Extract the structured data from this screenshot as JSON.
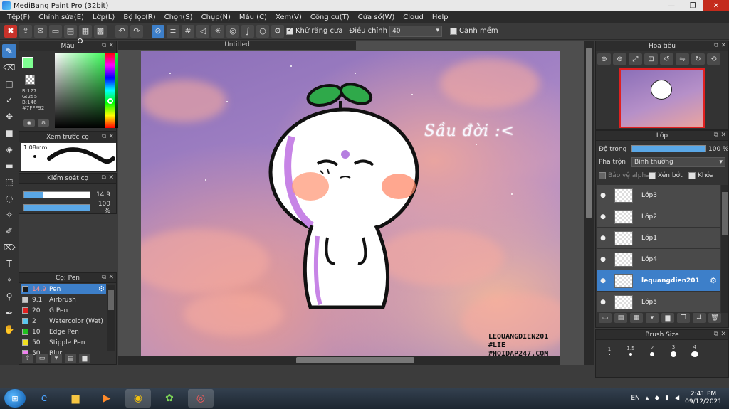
{
  "window": {
    "title": "MediBang Paint Pro (32bit)",
    "min": "—",
    "max": "❐",
    "close": "✕"
  },
  "menu": [
    "Tệp(F)",
    "Chỉnh sửa(E)",
    "Lớp(L)",
    "Bộ lọc(R)",
    "Chọn(S)",
    "Chụp(N)",
    "Màu (C)",
    "Xem(V)",
    "Công cụ(T)",
    "Cửa sổ(W)",
    "Cloud",
    "Help"
  ],
  "toolbar": {
    "antialias_label": "Khử răng cưa",
    "adjust_label": "Điều chỉnh",
    "adjust_value": "40",
    "edge_label": "Cạnh mềm"
  },
  "panels": {
    "color": {
      "title": "Màu",
      "fg_color": "#7fff92",
      "r": "R:127",
      "g": "G:255",
      "b": "B:146",
      "hex": "#7FFF92"
    },
    "preview": {
      "title": "Xem trước cọ",
      "size": "1.08mm"
    },
    "control": {
      "title": "Kiểm soát cọ",
      "size_value": "14.9",
      "size_fill": 0.28,
      "opacity_value": "100 %",
      "opacity_fill": 1.0
    },
    "brush": {
      "title": "Cọ: Pen",
      "items": [
        {
          "size": "14.9",
          "name": "Pen",
          "color": "#1a1a1a",
          "selected": true
        },
        {
          "size": "9.1",
          "name": "Airbrush",
          "color": "#c8c8c8"
        },
        {
          "size": "20",
          "name": "G Pen",
          "color": "#e02020"
        },
        {
          "size": "2",
          "name": "Watercolor (Wet)",
          "color": "#5ac8f0"
        },
        {
          "size": "10",
          "name": "Edge Pen",
          "color": "#20c020"
        },
        {
          "size": "50",
          "name": "Stipple Pen",
          "color": "#f0e020"
        },
        {
          "size": "50",
          "name": "Blur",
          "color": "#f080f0"
        }
      ]
    },
    "navigator": {
      "title": "Hoa tiêu"
    },
    "layer": {
      "title": "Lớp",
      "opacity_label": "Độ trong",
      "opacity_value": "100 %",
      "blend_label": "Pha trộn",
      "blend_value": "Bình thường",
      "protect_alpha": "Bảo vệ alpha",
      "clipping": "Xén bớt",
      "lock": "Khóa",
      "layers": [
        "Lớp3",
        "Lớp2",
        "Lớp1",
        "Lớp4",
        "lequangdien201",
        "Lớp5"
      ],
      "selected_index": 4
    },
    "brush_size": {
      "title": "Brush Size",
      "sizes": [
        "1",
        "1.5",
        "2",
        "3",
        "4"
      ]
    }
  },
  "canvas": {
    "tab_title": "Untitled",
    "caption": "Sầu đời :<",
    "watermark": [
      "LEQUANGDIEN201",
      "#LIE",
      "#HOIDAP247.COM"
    ]
  },
  "taskbar": {
    "lang": "EN",
    "time": "2:41 PM",
    "date": "09/12/2021"
  }
}
